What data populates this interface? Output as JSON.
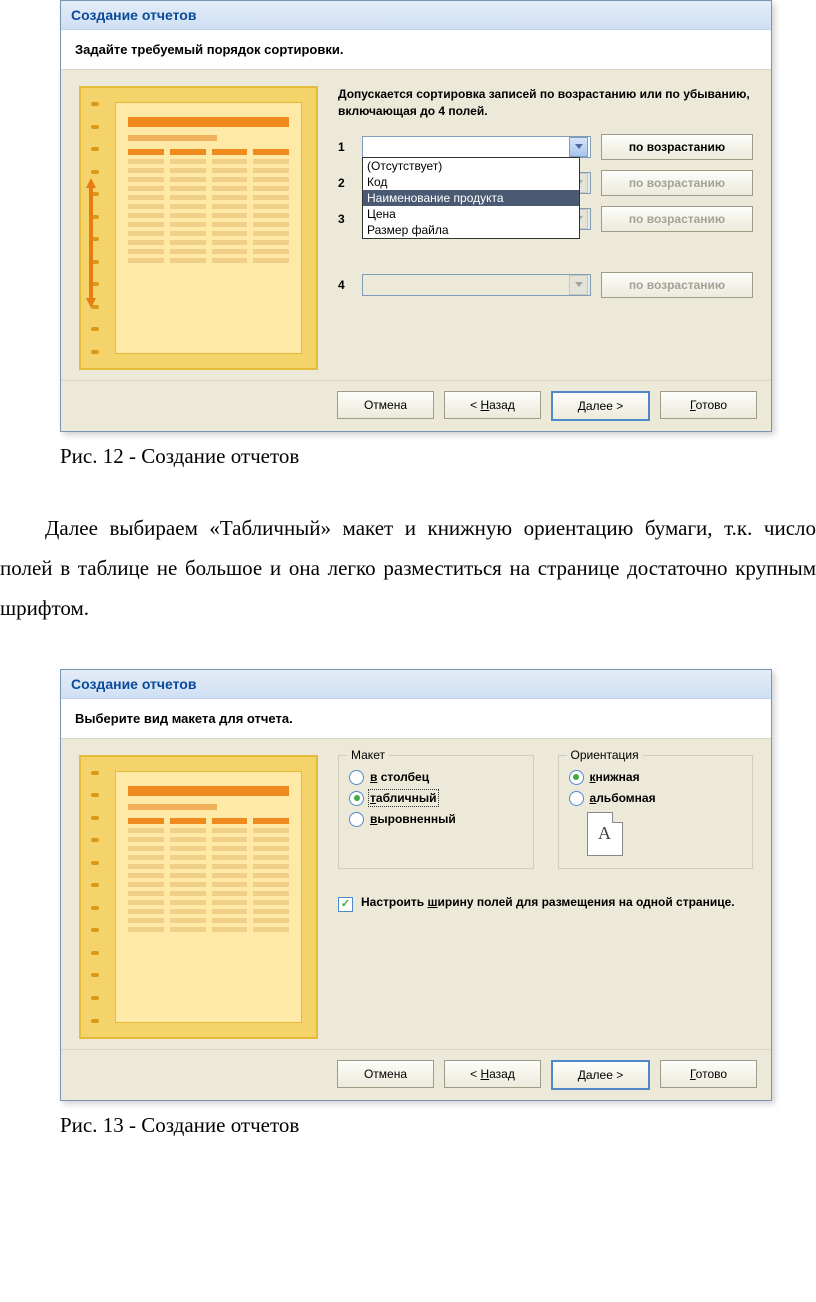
{
  "fig12": {
    "title": "Создание отчетов",
    "subhead": "Задайте требуемый порядок сортировки.",
    "hint": "Допускается сортировка записей по возрастанию или по убыванию, включающая до 4 полей.",
    "rows": [
      "1",
      "2",
      "3",
      "4"
    ],
    "asc_label": "по возрастанию",
    "dropdown": {
      "options": [
        "(Отсутствует)",
        "Код",
        "Наименование продукта",
        "Цена",
        "Размер файла"
      ],
      "selected_index": 2
    },
    "footer": {
      "cancel": "Отмена",
      "back": "< Назад",
      "next": "Далее >",
      "finish": "Готово"
    }
  },
  "caption12": "Рис. 12 - Создание отчетов",
  "paragraph": "Далее выбираем «Табличный» макет и книжную ориентацию бумаги, т.к. число полей в таблице не большое и она легко разместиться на странице достаточно крупным шрифтом.",
  "fig13": {
    "title": "Создание отчетов",
    "subhead": "Выберите вид макета для отчета.",
    "layout_group": "Макет",
    "orient_group": "Ориентация",
    "layouts": {
      "column": "в столбец",
      "table": "табличный",
      "aligned": "выровненный"
    },
    "orients": {
      "portrait": "книжная",
      "landscape": "альбомная"
    },
    "page_icon_letter": "A",
    "checkbox": "Настроить ширину полей для размещения на одной странице.",
    "footer": {
      "cancel": "Отмена",
      "back": "< Назад",
      "next": "Далее >",
      "finish": "Готово"
    }
  },
  "caption13": "Рис. 13 - Создание отчетов"
}
